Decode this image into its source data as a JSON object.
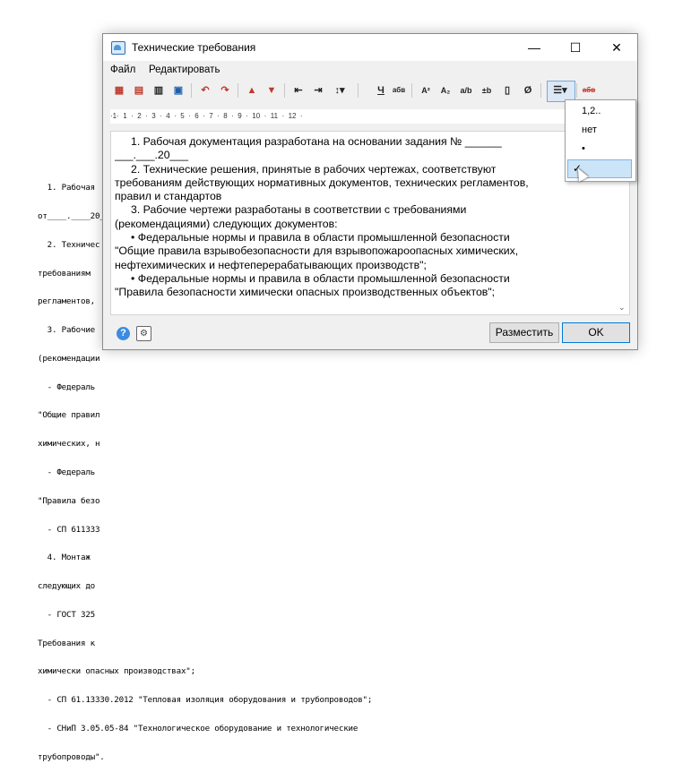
{
  "background_doc": {
    "lines": [
      "  1. Рабочая",
      "от____.____20__",
      "  2. Техничес",
      "требованиям",
      "регламентов,",
      "  3. Рабочие",
      "(рекомендации",
      "  - Федераль",
      "\"Общие правил",
      "химических, н",
      "  - Федераль",
      "\"Правила безо",
      "  - СП 611333",
      "  4. Монтаж",
      "следующих до",
      "  - ГОСТ 325",
      "Требования к",
      "химически опасных производствах\";",
      "  - СП 61.13330.2012 \"Тепловая изоляция оборудования и трубопроводов\";",
      "  - СНиП 3.05.05-84 \"Технологическое оборудование и технологические",
      "трубопроводы\"."
    ]
  },
  "window": {
    "title": "Технические требования",
    "minimize": "—",
    "maximize": "☐",
    "close": "✕"
  },
  "menu": {
    "file": "Файл",
    "edit": "Редактировать"
  },
  "toolbar": {
    "underline": "Ч",
    "case": "абв",
    "superscript": "A²",
    "subscript": "A₂",
    "fraction": "a/b",
    "tolerance": "±b",
    "symbol": "Ø",
    "list": "☰▾",
    "spellcheck": "абв"
  },
  "ruler": {
    "text": "·1·  1  ·  2  ·  3  ·  4  ·  5  ·  6  ·  7  ·  8  ·  9  ·  10  ·  11  ·  12  ·"
  },
  "editor": {
    "lines": [
      "1.   Рабочая документация разработана на основании задания № ______",
      "___.___.20___",
      "2.   Технические решения, принятые в рабочих чертежах, соответствуют",
      "требованиям действующих нормативных документов, технических регламентов,",
      "правил и стандартов",
      "3.   Рабочие чертежи разработаны в соответствии с требованиями",
      "(рекомендациями) следующих документов:",
      "•      Федеральные нормы и правила в области промышленной безопасности",
      "\"Общие правила взрывобезопасности для взрывопожароопасных химических,",
      "нефтехимических и нефтеперерабатывающих производств\";",
      "•      Федеральные нормы и правила в области промышленной безопасности",
      "\"Правила безопасности химически опасных производственных объектов\";"
    ]
  },
  "footer": {
    "help": "?",
    "place_button": "Разместить",
    "ok_button": "OK"
  },
  "list_dropdown": {
    "items": [
      "1,2..",
      "нет",
      "•",
      ""
    ],
    "checked_index": 3,
    "check_mark": "✓"
  }
}
